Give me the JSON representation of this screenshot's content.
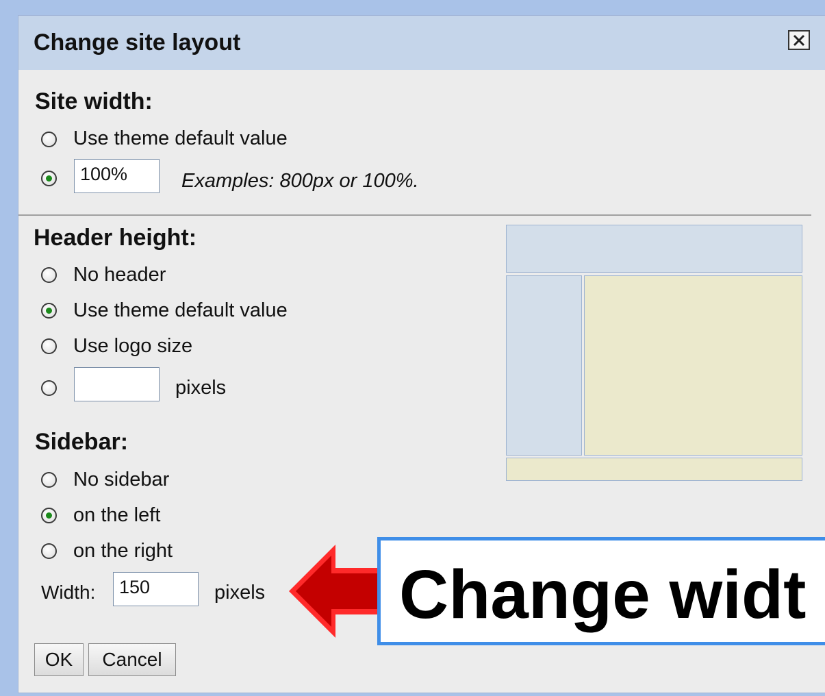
{
  "dialog": {
    "title": "Change site layout",
    "close_icon": "close-x-icon"
  },
  "site_width": {
    "heading": "Site width:",
    "option_default": "Use theme default value",
    "custom_value": "100%",
    "examples": "Examples: 800px or 100%.",
    "selected": "custom"
  },
  "header_height": {
    "heading": "Header height:",
    "options": [
      "No header",
      "Use theme default value",
      "Use logo size"
    ],
    "custom_value": "",
    "unit": "pixels",
    "selected": "Use theme default value"
  },
  "sidebar": {
    "heading": "Sidebar:",
    "options": [
      "No sidebar",
      "on the left",
      "on the right"
    ],
    "selected": "on the left",
    "width_label": "Width:",
    "width_value": "150",
    "unit": "pixels"
  },
  "buttons": {
    "ok": "OK",
    "cancel": "Cancel"
  },
  "annotation": {
    "callout_text": "Change widt",
    "arrow_icon": "red-left-arrow-icon",
    "arrow_color": "#cc0000",
    "border_color": "#3f8ee8"
  },
  "colors": {
    "titlebar": "#c5d5ea",
    "preview_header_sidebar": "#d3deea",
    "preview_content": "#ebe9cc",
    "radio_selected": "#1b8a1b"
  }
}
